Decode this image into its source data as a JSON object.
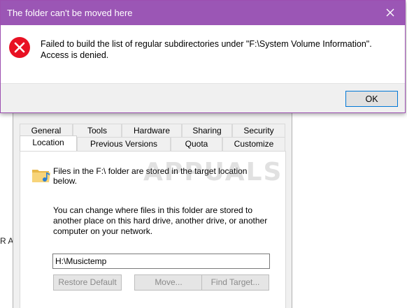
{
  "background": {
    "left_text": "R A",
    "tabs_row1": [
      "General",
      "Tools",
      "Hardware",
      "Sharing",
      "Security"
    ],
    "tabs_row2": [
      "Location",
      "Previous Versions",
      "Quota",
      "Customize"
    ],
    "info_text": "Files in the F:\\ folder are stored in the target location below.",
    "change_text": "You can change where files in this folder are stored to another place on this hard drive, another drive, or another computer on your network.",
    "path_value": "H:\\Musictemp",
    "buttons": {
      "restore": "Restore Default",
      "move": "Move...",
      "find": "Find Target..."
    },
    "watermark": "APPUALS"
  },
  "error_dialog": {
    "title": "The folder can't be moved here",
    "message": "Failed to build the list of regular subdirectories under \"F:\\System Volume Information\". Access is denied.",
    "ok_label": "OK",
    "title_bar_color": "#9b56b5"
  }
}
